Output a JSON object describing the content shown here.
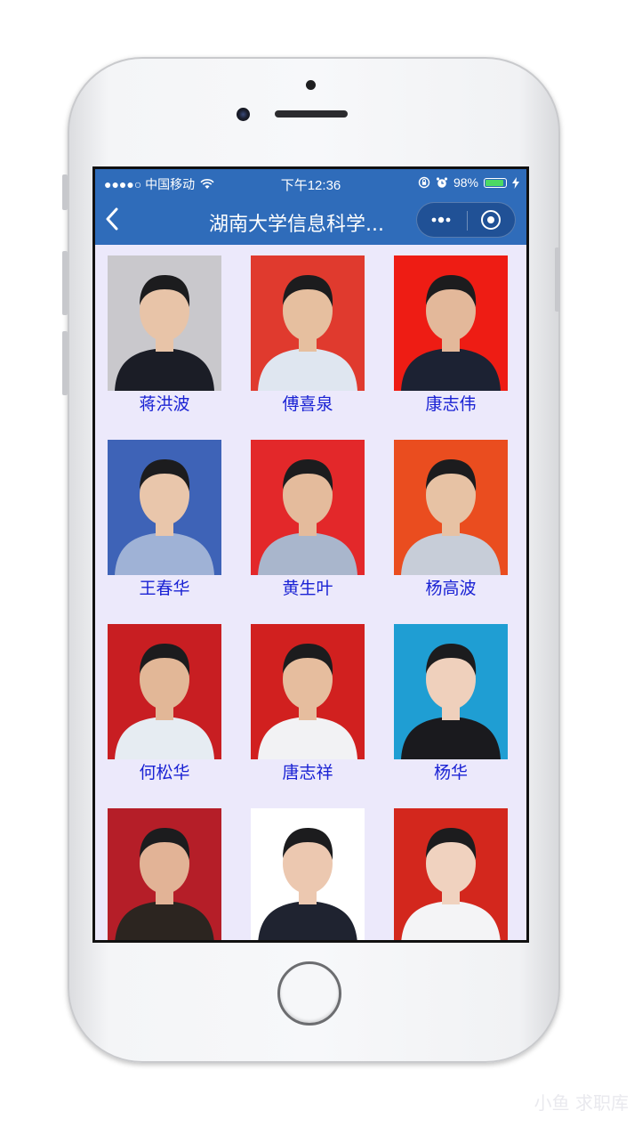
{
  "status_bar": {
    "carrier": "●●●●○ 中国移动",
    "time": "下午12:36",
    "battery": "98%",
    "battery_level": 0.98
  },
  "nav": {
    "back_icon": "chevron-left-icon",
    "title": "湖南大学信息科学...",
    "more_icon": "more-dots-icon",
    "close_icon": "target-circle-icon"
  },
  "people": [
    {
      "name": "蒋洪波",
      "bg": "#c9c8cc"
    },
    {
      "name": "傅喜泉",
      "bg": "#e03a2e"
    },
    {
      "name": "康志伟",
      "bg": "#ee1c14"
    },
    {
      "name": "王春华",
      "bg": "#3e63b7"
    },
    {
      "name": "黄生叶",
      "bg": "#e3282a"
    },
    {
      "name": "杨高波",
      "bg": "#ea4d1f"
    },
    {
      "name": "何松华",
      "bg": "#c81e22"
    },
    {
      "name": "唐志祥",
      "bg": "#d1201f"
    },
    {
      "name": "杨华",
      "bg": "#1f9ed3"
    },
    {
      "name": "",
      "bg": "#b51e28"
    },
    {
      "name": "",
      "bg": "#ffffff"
    },
    {
      "name": "",
      "bg": "#d3271d"
    }
  ],
  "watermark": "小鱼 求职库"
}
